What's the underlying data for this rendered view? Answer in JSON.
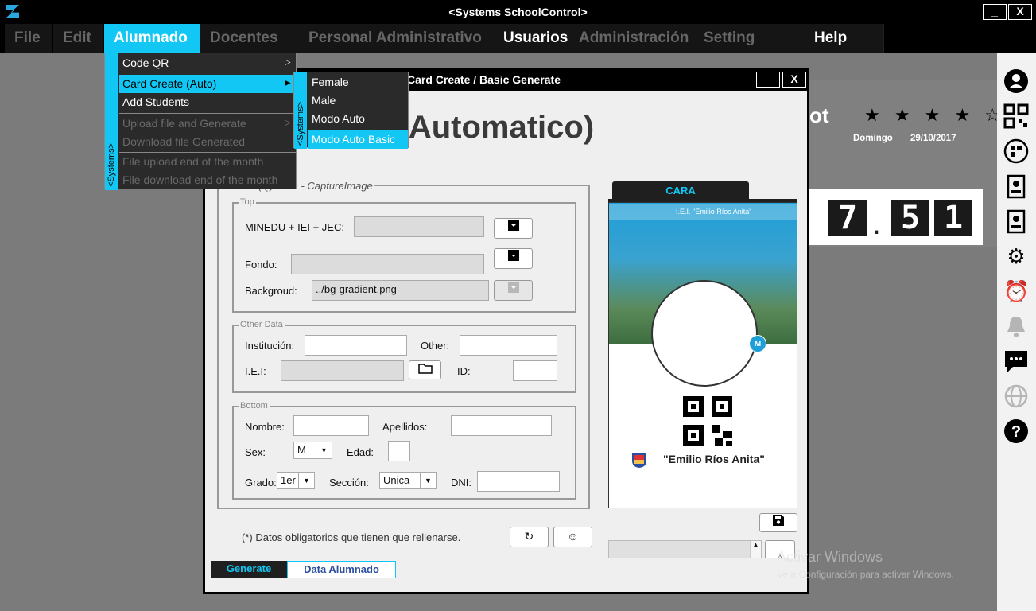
{
  "app": {
    "title": "<Systems SchoolControl>",
    "min": "_",
    "close": "X"
  },
  "menubar": [
    "File",
    "Edit",
    "Alumnado",
    "Docentes",
    "Personal Administrativo",
    "Usuarios",
    "Administración",
    "Setting",
    "Help"
  ],
  "dashboard": {
    "title_partial": "ot",
    "rating": 4,
    "stars": "★ ★ ★ ★ ☆",
    "day": "Domingo",
    "date": "29/10/2017",
    "clock": [
      "7",
      "5",
      "1"
    ],
    "clock_sep": "."
  },
  "dropdown": {
    "side_label": "<Systems>",
    "items": [
      "Code QR",
      "Card Create (Auto)",
      "Add Students",
      "Upload file and Generate",
      "Download file Generated",
      "File upload end of the month",
      "File download end of the month"
    ]
  },
  "submenu": {
    "side_label": "<Systems>",
    "items": [
      "Female",
      "Male",
      "Modo Auto",
      "Modo Auto Basic"
    ]
  },
  "window": {
    "title": "Card Create / Basic Generate",
    "heading": "Generate (Automatico)",
    "capture_legend": "(Q) Data - CaptureImage",
    "top_legend": "Top",
    "minedu_label": "MINEDU + IEI + JEC:",
    "fondo_label": "Fondo:",
    "backgroud_label": "Backgroud:",
    "backgroud_value": "../bg-gradient.png",
    "other_legend": "Other Data",
    "institucion_label": "Institución:",
    "other_label": "Other:",
    "iei_label": "I.E.I:",
    "id_label": "ID:",
    "bottom_legend": "Bottom",
    "nombre_label": "Nombre:",
    "apellidos_label": "Apellidos:",
    "sex_label": "Sex:",
    "sex_value": "M",
    "edad_label": "Edad:",
    "grado_label": "Grado:",
    "grado_value": "1er",
    "seccion_label": "Sección:",
    "seccion_value": "Unica",
    "dni_label": "DNI:",
    "note": "(*) Datos obligatorios que tienen que rellenarse.",
    "card_tab": "CARA",
    "card_header": "I.E.I. \"Emilio Ríos Anita\"",
    "card_badge": "M",
    "card_school": "\"Emilio Ríos Anita\"",
    "tabs": [
      "Generate",
      "Data Alumnado"
    ]
  },
  "watermark": {
    "line1": "Activar Windows",
    "line2": "Ve a Configuración para activar Windows."
  },
  "colors": {
    "accent": "#12c7f3",
    "menubar": "#000000",
    "window_bg": "#efefef"
  }
}
